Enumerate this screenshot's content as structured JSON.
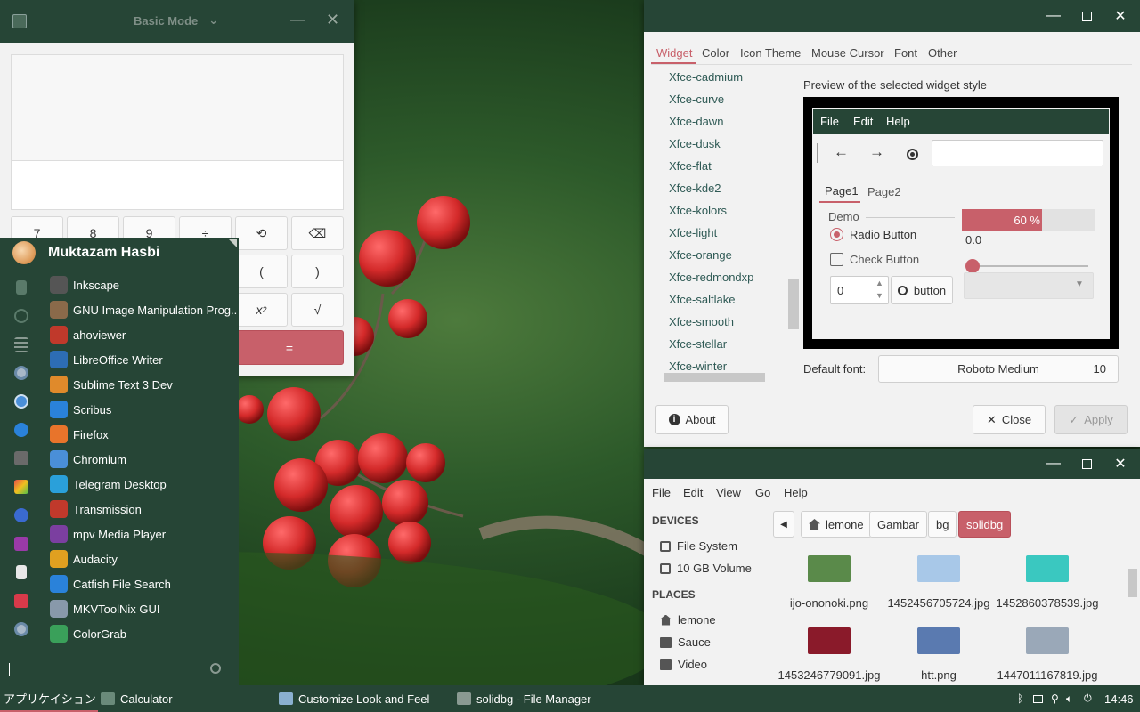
{
  "calculator": {
    "mode_label": "Basic Mode",
    "minimize_icon": "minimize-icon",
    "close_icon": "close-icon",
    "keys_row1": [
      "7",
      "8",
      "9",
      "÷"
    ],
    "open_paren": "(",
    "close_paren": ")",
    "x_squared_base": "x",
    "x_squared_exp": "2",
    "sqrt": "√",
    "equals": "="
  },
  "app_menu": {
    "user_name": "Muktazam Hasbi",
    "apps": [
      {
        "label": "Inkscape",
        "icon": "inkscape-icon",
        "color": "#555555"
      },
      {
        "label": "GNU Image Manipulation Prog...",
        "icon": "gimp-icon",
        "color": "#8a6a4a"
      },
      {
        "label": "ahoviewer",
        "icon": "ahoviewer-icon",
        "color": "#c0392b"
      },
      {
        "label": "LibreOffice Writer",
        "icon": "writer-icon",
        "color": "#2d6db5"
      },
      {
        "label": "Sublime Text 3 Dev",
        "icon": "sublime-icon",
        "color": "#e08a2b"
      },
      {
        "label": "Scribus",
        "icon": "scribus-icon",
        "color": "#2a82da"
      },
      {
        "label": "Firefox",
        "icon": "firefox-icon",
        "color": "#e8742b"
      },
      {
        "label": "Chromium",
        "icon": "chromium-icon",
        "color": "#4a8fd8"
      },
      {
        "label": "Telegram Desktop",
        "icon": "telegram-icon",
        "color": "#2aa0da"
      },
      {
        "label": "Transmission",
        "icon": "transmission-icon",
        "color": "#c0392b"
      },
      {
        "label": "mpv Media Player",
        "icon": "mpv-icon",
        "color": "#7b3fa0"
      },
      {
        "label": "Audacity",
        "icon": "audacity-icon",
        "color": "#e0a020"
      },
      {
        "label": "Catfish File Search",
        "icon": "catfish-icon",
        "color": "#2a82da"
      },
      {
        "label": "MKVToolNix GUI",
        "icon": "mkvtoolnix-icon",
        "color": "#8899aa"
      },
      {
        "label": "ColorGrab",
        "icon": "colorgrab-icon",
        "color": "#3aa05a"
      }
    ],
    "search_placeholder": "",
    "search_icon": "search-icon"
  },
  "taskbar": {
    "applications_label": "アプリケイション",
    "items": [
      "Calculator",
      "Customize Look and Feel",
      "solidbg - File Manager"
    ],
    "clock": "14:46"
  },
  "look_and_feel": {
    "tabs": [
      "Widget",
      "Color",
      "Icon Theme",
      "Mouse Cursor",
      "Font",
      "Other"
    ],
    "themes": [
      "Xfce-cadmium",
      "Xfce-curve",
      "Xfce-dawn",
      "Xfce-dusk",
      "Xfce-flat",
      "Xfce-kde2",
      "Xfce-kolors",
      "Xfce-light",
      "Xfce-orange",
      "Xfce-redmondxp",
      "Xfce-saltlake",
      "Xfce-smooth",
      "Xfce-stellar",
      "Xfce-winter"
    ],
    "preview_heading": "Preview of the selected widget style",
    "preview": {
      "menu": [
        "File",
        "Edit",
        "Help"
      ],
      "page_tabs": [
        "Page1",
        "Page2"
      ],
      "frame_label": "Demo",
      "progress_label": "60 %",
      "progress_value": 0.6,
      "scale_value": "0.0",
      "radio_label": "Radio Button",
      "check_label": "Check Button",
      "spin_value": "0",
      "button_label": "button"
    },
    "default_font_label": "Default font:",
    "font_name": "Roboto Medium",
    "font_size": "10",
    "about_label": "About",
    "close_label": "Close",
    "apply_label": "Apply"
  },
  "file_manager": {
    "menu": [
      "File",
      "Edit",
      "View",
      "Go",
      "Help"
    ],
    "devices_heading": "DEVICES",
    "devices": [
      "File System",
      "10 GB Volume"
    ],
    "places_heading": "PLACES",
    "places": [
      "lemone",
      "Sauce",
      "Video"
    ],
    "breadcrumbs": [
      "lemone",
      "Gambar",
      "bg",
      "solidbg"
    ],
    "files": [
      {
        "name": "ijo-ononoki.png",
        "color": "#5a8a4a"
      },
      {
        "name": "1452456705724.jpg",
        "color": "#a8c8e8"
      },
      {
        "name": "1452860378539.jpg",
        "color": "#3ac8c0"
      },
      {
        "name": "1453246779091.jpg",
        "color": "#8a1a2a"
      },
      {
        "name": "htt.png",
        "color": "#5a7ab0"
      },
      {
        "name": "1447011167819.jpg",
        "color": "#9aa8b8"
      }
    ]
  },
  "colors": {
    "panel_green": "#264536",
    "accent_red": "#c8606a",
    "link_teal": "#2f5a55"
  }
}
